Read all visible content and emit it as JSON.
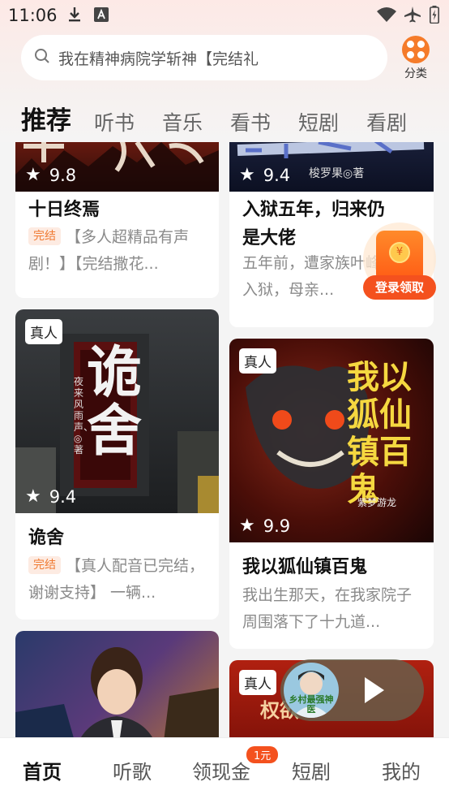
{
  "status_bar": {
    "time": "11:06"
  },
  "search": {
    "placeholder": "我在精神病院学斩神【完结礼"
  },
  "category": {
    "label": "分类"
  },
  "tabs": [
    "推荐",
    "听书",
    "音乐",
    "看书",
    "短剧",
    "看剧"
  ],
  "books": [
    {
      "title": "十日终焉",
      "rating": "9.8",
      "tag": "完结",
      "description": "【多人超精品有声剧！】【完结撒花..."
    },
    {
      "title": "入狱五年，归来仍是大佬",
      "title_line1": "入狱五年，归来仍",
      "title_line2": "是大佬",
      "rating": "9.4",
      "cover_author": "梭罗果◎著",
      "description": "五年前，遭家族叶峰银铛入狱，母亲..."
    },
    {
      "title": "诡舍",
      "rating": "9.4",
      "badge": "真人",
      "tag": "完结",
      "cover_title": "诡舍",
      "cover_text": "夜来风雨声、◎著",
      "description": "【真人配音已完结，谢谢支持】 一辆..."
    },
    {
      "title": "我以狐仙镇百鬼",
      "rating": "9.9",
      "badge": "真人",
      "cover_title": "我以狐仙镇百鬼",
      "cover_author": "紫梦游龙",
      "description": "我出生那天，在我家院子周围落下了十九道..."
    },
    {
      "title": ""
    },
    {
      "badge": "真人",
      "cover_text": "权欲"
    }
  ],
  "promo": {
    "label": "登录领取"
  },
  "mini_player": {
    "cover_text": "乡村最强神医"
  },
  "bottom_nav": {
    "items": [
      "首页",
      "听歌",
      "领现金",
      "短剧",
      "我的"
    ],
    "badge": "1元"
  },
  "colors": {
    "accent": "#f4511e",
    "orange": "#f57b2a",
    "tag_text": "#f07a32"
  }
}
